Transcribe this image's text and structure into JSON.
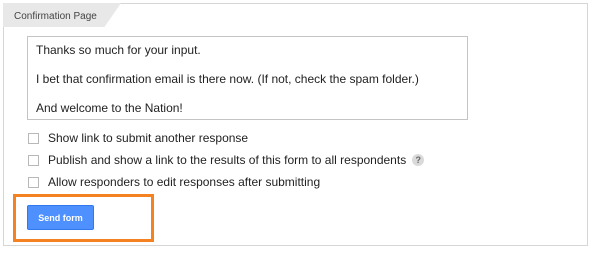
{
  "section": {
    "title": "Confirmation Page"
  },
  "confirmation_message": {
    "lines": [
      "Thanks so much for your input.",
      "I bet that confirmation email is there now. (If not, check the spam folder.)",
      "And welcome to the Nation!"
    ]
  },
  "options": [
    {
      "label": "Show link to submit another response",
      "checked": false
    },
    {
      "label": "Publish and show a link to the results of this form to all respondents",
      "checked": false,
      "help_icon": "?"
    },
    {
      "label": "Allow responders to edit responses after submitting",
      "checked": false
    }
  ],
  "send_button": {
    "label": "Send form",
    "color": "#4d90fe"
  },
  "highlight_color": "#f58220"
}
